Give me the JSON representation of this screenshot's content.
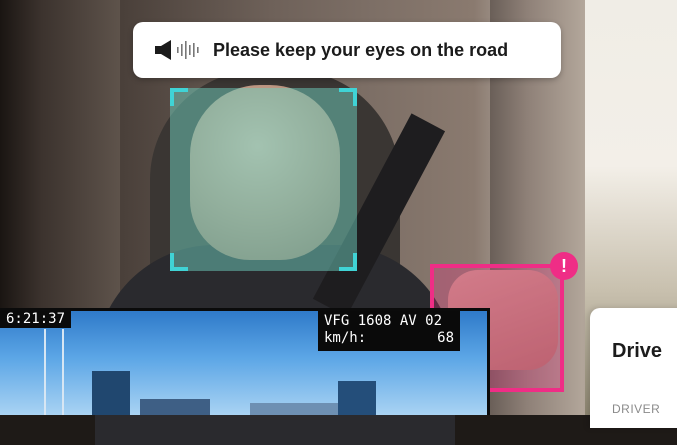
{
  "alert": {
    "message": "Please keep your eyes on the road",
    "icon": "speaker-icon"
  },
  "detection": {
    "face_box_color": "#40d3d5",
    "phone_box_color": "#ef2d86",
    "warning_badge": "!"
  },
  "dashcam": {
    "timestamp": "6:21:37",
    "vehicle_id": "VFG 1608 AV 02",
    "speed_label": "km/h:",
    "speed_value": "68"
  },
  "card": {
    "title": "Drive",
    "subtitle": "DRIVER"
  }
}
